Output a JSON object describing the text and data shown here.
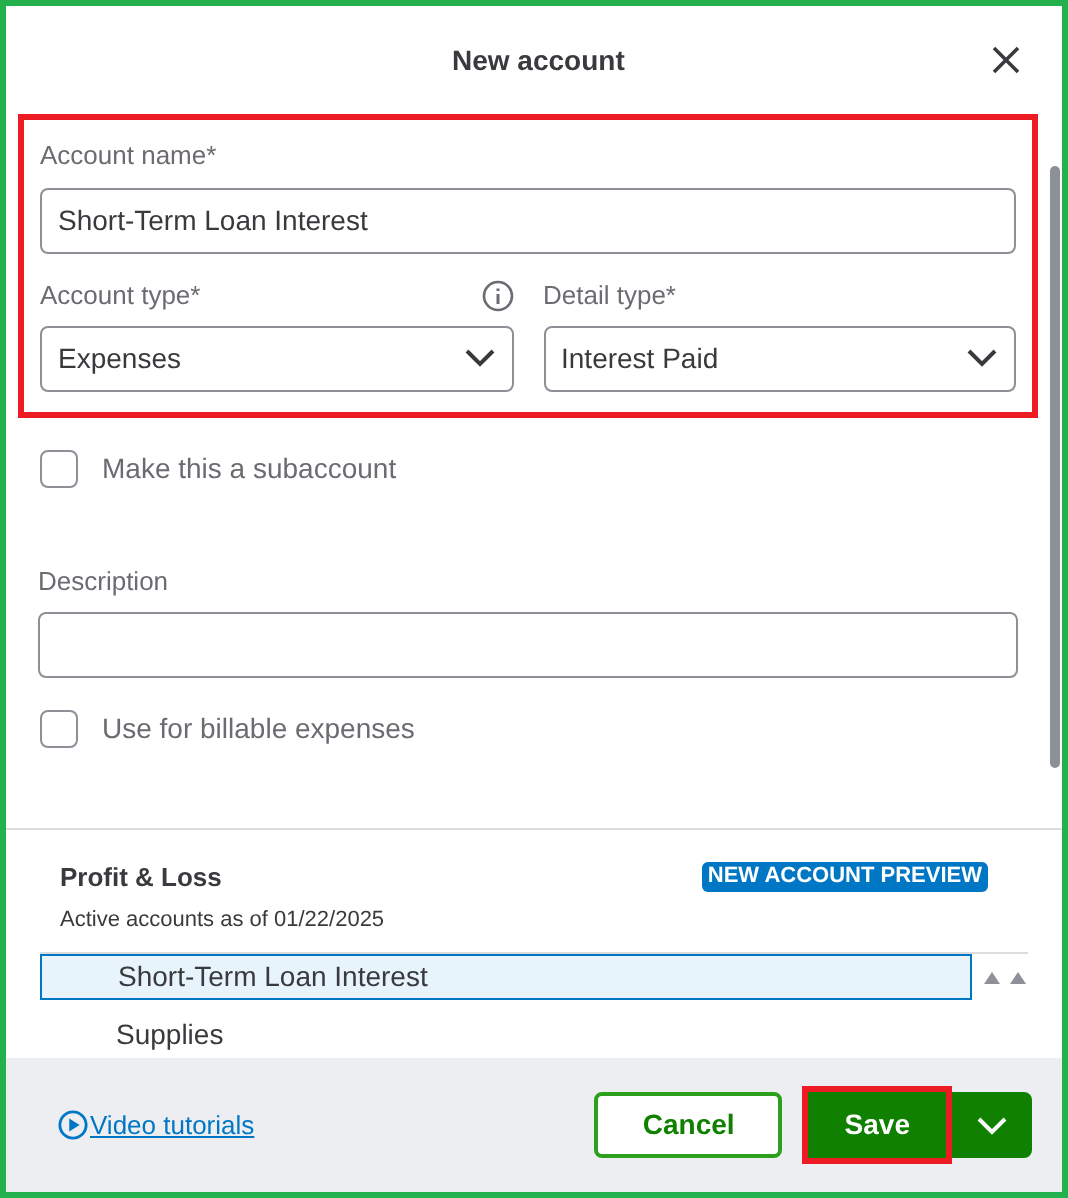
{
  "dialog": {
    "title": "New account"
  },
  "account_name": {
    "label": "Account name*",
    "value": "Short-Term Loan Interest"
  },
  "account_type": {
    "label": "Account type*",
    "value": "Expenses"
  },
  "detail_type": {
    "label": "Detail type*",
    "value": "Interest Paid"
  },
  "subaccount": {
    "label": "Make this a subaccount",
    "checked": false
  },
  "description": {
    "label": "Description"
  },
  "billable": {
    "label": "Use for billable expenses",
    "checked": false
  },
  "preview": {
    "title": "Profit & Loss",
    "badge": "NEW ACCOUNT PREVIEW",
    "subtitle": "Active accounts as of 01/22/2025",
    "rows": [
      {
        "label": "Short-Term Loan Interest",
        "selected": true
      },
      {
        "label": "Supplies",
        "selected": false
      }
    ]
  },
  "footer": {
    "link": "Video tutorials",
    "cancel": "Cancel",
    "save": "Save"
  }
}
